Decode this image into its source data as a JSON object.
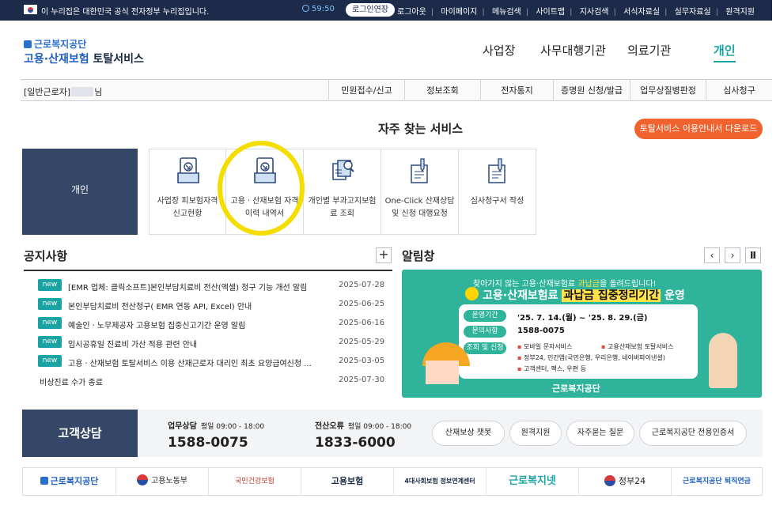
{
  "gov_bar": {
    "notice": "이 누리집은 대한민국 공식 전자정부 누리집입니다.",
    "timer": "59:50",
    "extend_label": "로그인연장",
    "links": [
      "로그아웃",
      "마이페이지",
      "메뉴검색",
      "사이트맵",
      "지사검색",
      "서식자료실",
      "실무자료실",
      "원격지원"
    ]
  },
  "header": {
    "org_name": "근로복지공단",
    "service_blue": "고용·산재보험",
    "service_dark": "토탈서비스",
    "nav": [
      "사업장",
      "사무대행기관",
      "의료기관",
      "개인"
    ],
    "active_nav": "개인"
  },
  "sub_bar": {
    "user_prefix": "[일반근로자]",
    "user_suffix": "님",
    "items": [
      "민원접수/신고",
      "정보조회",
      "전자통지",
      "증명원 신청/발급",
      "업무상질병판정",
      "심사청구"
    ]
  },
  "favorites": {
    "title": "자주 찾는 서비스",
    "guide_button": "토탈서비스 이용안내서 다운로드",
    "tab_label": "개인",
    "services": [
      {
        "label": "사업장 피보험자격 신고현황",
        "icon": "report-tray-icon"
      },
      {
        "label": "고용ㆍ산재보험 자격 이력 내역서",
        "icon": "history-tray-icon"
      },
      {
        "label": "개인별 부과고지보험료 조회",
        "icon": "document-search-icon"
      },
      {
        "label": "One-Click 산재상담 및 신청 대행요청",
        "icon": "pen-document-icon"
      },
      {
        "label": "심사청구서 작성",
        "icon": "write-document-icon"
      }
    ]
  },
  "notice": {
    "title": "공지사항",
    "more_label": "+",
    "badge": "new",
    "items": [
      {
        "text": "[EMR 업체: 클릭소프트]본인부담치료비 전산(엑셀) 청구 기능 개선 알림",
        "date": "2025-07-28",
        "new": true
      },
      {
        "text": "본인부담치료비 전산청구( EMR 연동 API, Excel) 안내",
        "date": "2025-06-25",
        "new": true
      },
      {
        "text": "예술인ㆍ노무제공자 고용보험 집중신고기간 운영 알림",
        "date": "2025-06-16",
        "new": true
      },
      {
        "text": "임시공휴일 진료비 가산 적용 관련 안내",
        "date": "2025-05-29",
        "new": true
      },
      {
        "text": "고용ㆍ산재보험 토탈서비스 이용 산재근로자 대리인 최초 요양급여신청 ...",
        "date": "2025-03-05",
        "new": true
      },
      {
        "text": "비상진료 수가 종료",
        "date": "2025-07-30",
        "new": false
      }
    ]
  },
  "alarm": {
    "title": "알림창",
    "controls": [
      "‹",
      "›",
      "Ⅱ"
    ],
    "banner": {
      "top_line_a": "찾아가지 않는 고용·산재보험료",
      "top_line_b": "과납금",
      "top_line_c": "을 돌려드립니다!",
      "head_a": "고용·산재보험료",
      "head_hl": "과납금 집중정리기간",
      "head_b": "운영",
      "period_label": "운영기간",
      "period_value": "'25. 7. 14.(월) ~ '25. 8. 29.(금)",
      "contact_label": "문의사항",
      "contact_value": "1588-0075",
      "apply_label": "조회 및 신청",
      "apply_items": [
        "모바일 문자서비스",
        "고용산재보험 토탈서비스",
        "정부24, 민간앱(국민은행, 우리은행, 네이버파이낸셜)",
        "고객센터, 팩스, 우편 등"
      ],
      "footer": "근로복지공단"
    }
  },
  "customer": {
    "title": "고객상담",
    "work_label": "업무상담",
    "work_hours": "평일 09:00 - 18:00",
    "work_phone": "1588-0075",
    "it_label": "전산오류",
    "it_hours": "평일 09:00 - 18:00",
    "it_phone": "1833-6000",
    "buttons": [
      "산재보상 챗봇",
      "원격지원",
      "자주묻는 질문",
      "근로복지공단 전용인증서"
    ]
  },
  "partner_logos": [
    "근로복지공단",
    "고용노동부",
    "국민건강보험",
    "고용보험",
    "4대사회보험 정보연계센터",
    "근로복지넷",
    "정부24",
    "근로복지공단 퇴직연금"
  ],
  "colors": {
    "accent": "#1aa3a3",
    "navy": "#344766",
    "orange": "#f0622e",
    "banner": "#2fb39a",
    "highlight": "#f5dd00"
  }
}
